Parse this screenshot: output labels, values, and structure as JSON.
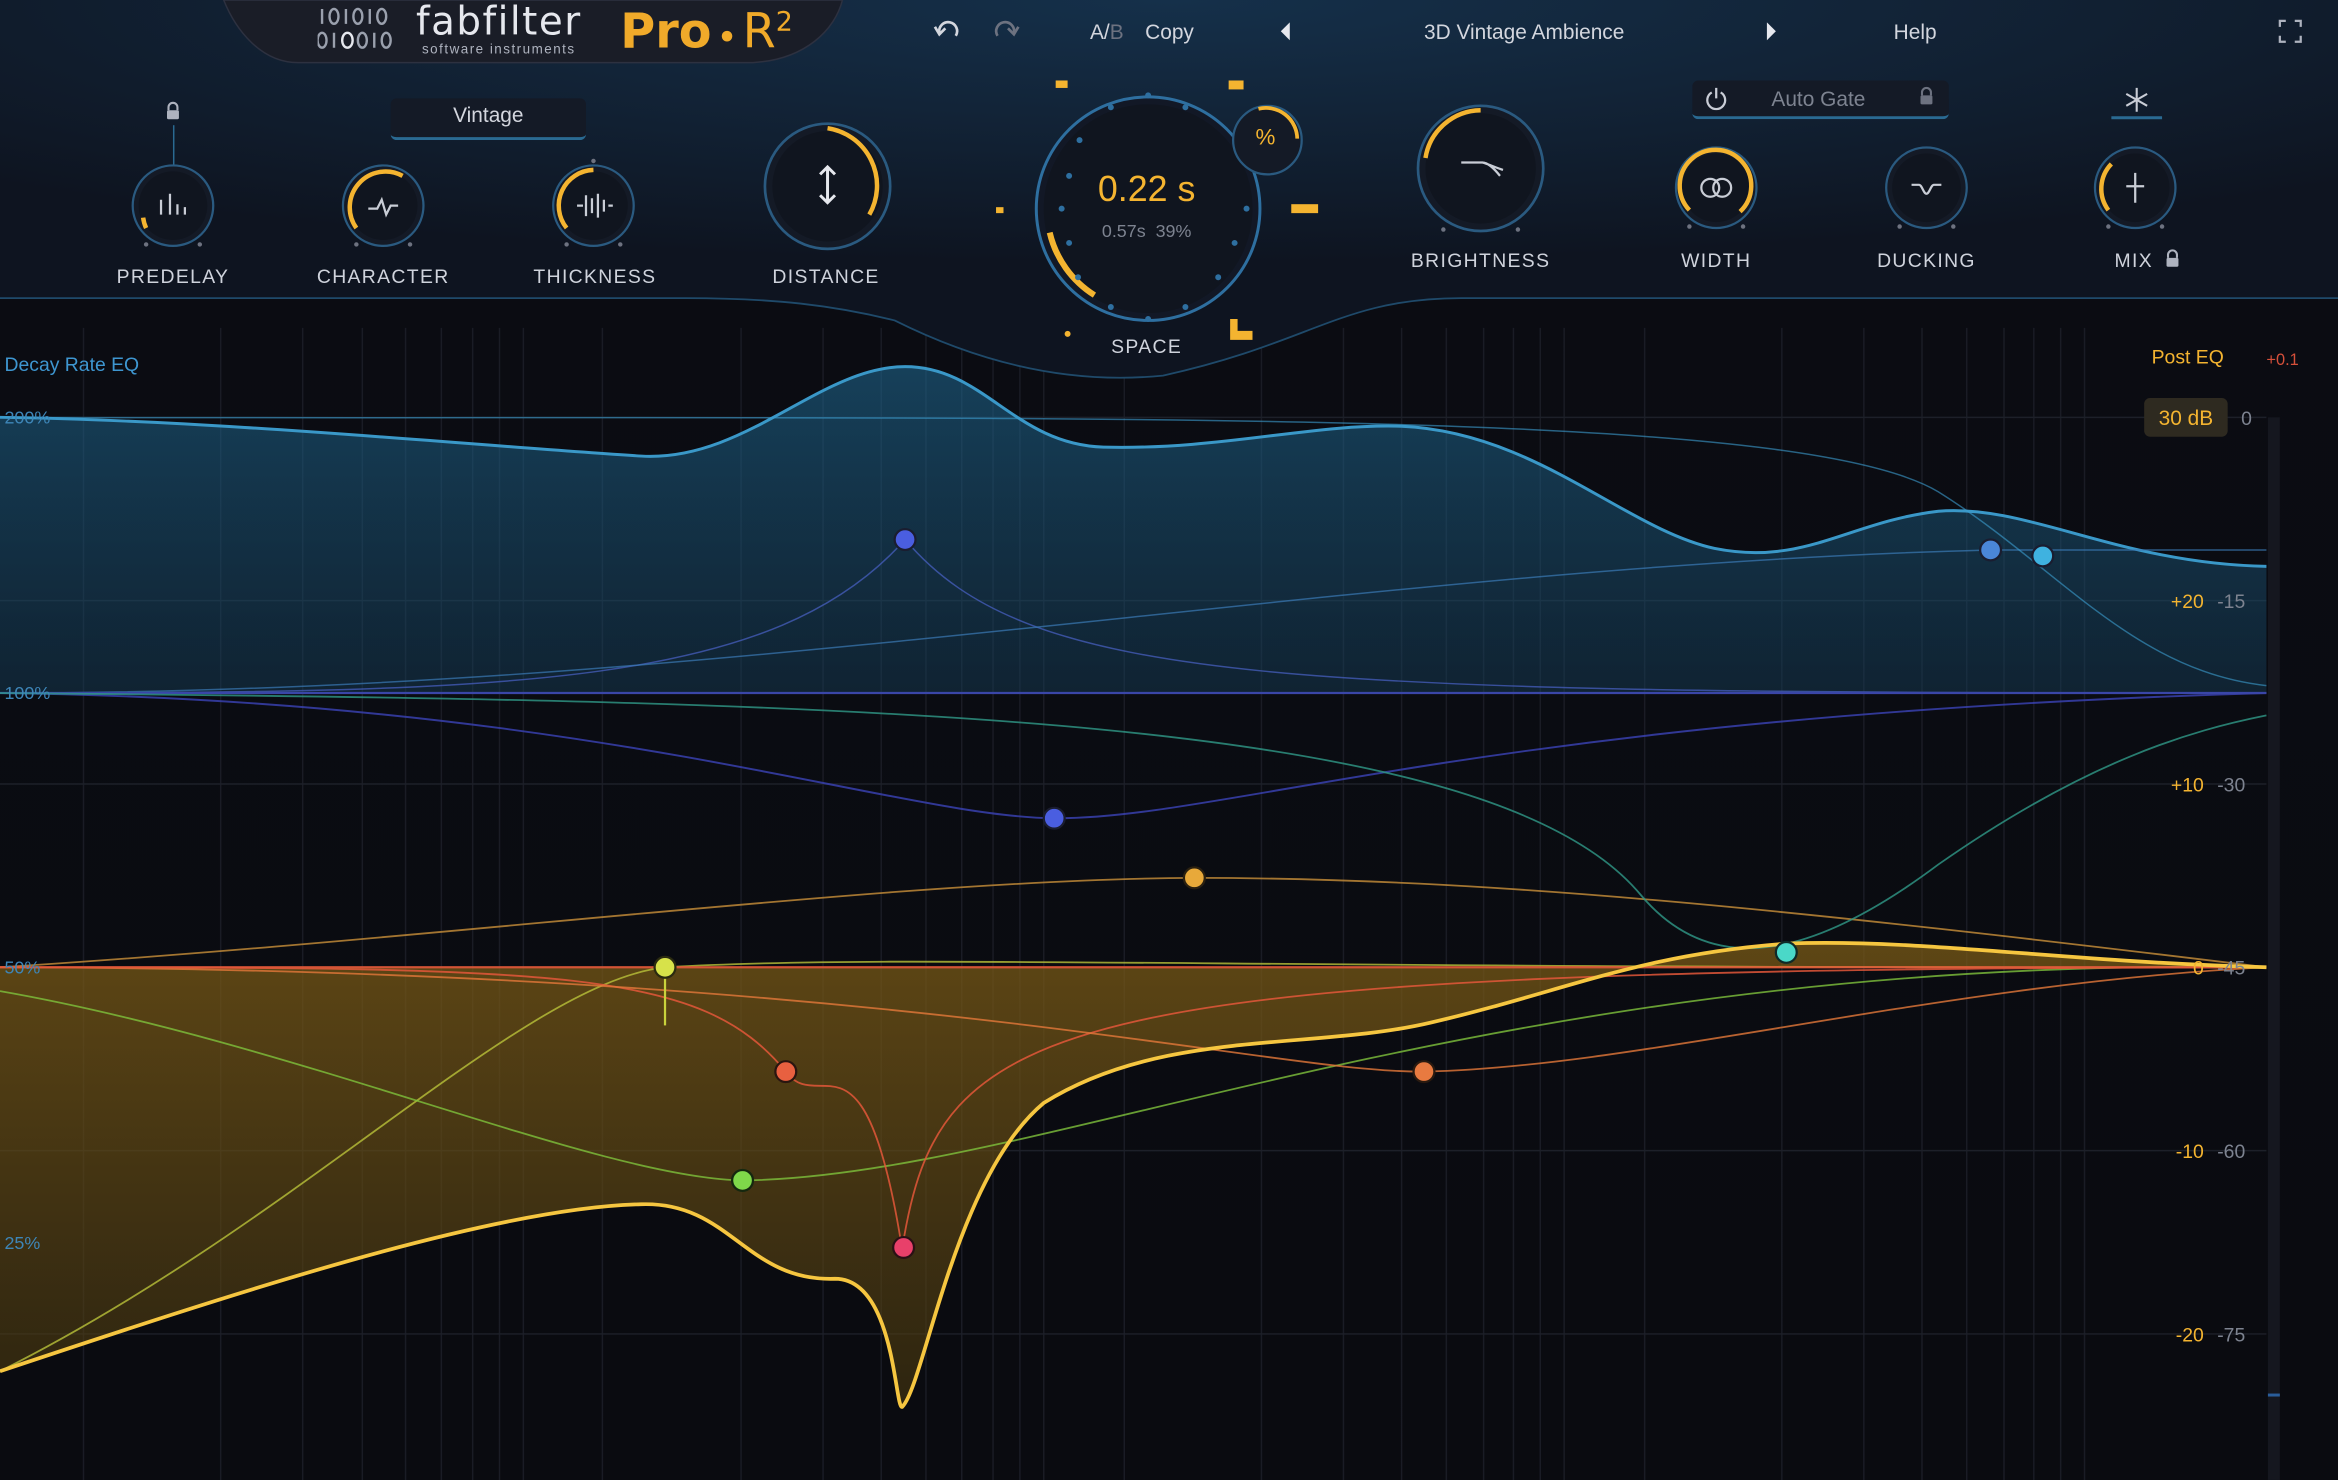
{
  "header": {
    "logo_brand": "fabfilter",
    "logo_sub": "software instruments",
    "product": "Pro",
    "product_dot": "•",
    "product_r": "R",
    "product_sup": "2",
    "ab_a": "A/",
    "ab_b": "B",
    "copy": "Copy",
    "preset": "3D Vintage Ambience",
    "help": "Help",
    "icons": [
      "undo-icon",
      "redo-icon",
      "prev-preset-icon",
      "next-preset-icon",
      "fullscreen-icon"
    ]
  },
  "controls": {
    "predelay": "PREDELAY",
    "character": "CHARACTER",
    "character_mode": "Vintage",
    "thickness": "THICKNESS",
    "distance": "DISTANCE",
    "space": "SPACE",
    "space_value": "0.22 s",
    "space_sub": "0.57s  39%",
    "percent_btn": "%",
    "brightness": "BRIGHTNESS",
    "auto_gate": "Auto Gate",
    "width": "WIDTH",
    "ducking": "DUCKING",
    "mix": "MIX"
  },
  "eq": {
    "decay_title": "Decay Rate EQ",
    "post_title": "Post EQ",
    "peak": "+0.1",
    "range_btn": "30 dB",
    "decay_pct": [
      "200%",
      "100%",
      "50%",
      "25%"
    ],
    "post_db": [
      "+20",
      "+10",
      "0",
      "-10",
      "-20"
    ],
    "meter_db": [
      "0",
      "-15",
      "-30",
      "-45",
      "-60",
      "-75"
    ]
  },
  "colors": {
    "accent": "#f4b430",
    "decay_blue": "#2f88b8",
    "post_gold": "#f2c23a",
    "background": "#0b0c12"
  }
}
